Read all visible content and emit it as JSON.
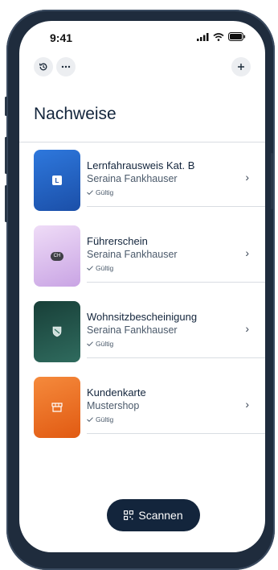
{
  "status_bar": {
    "time": "9:41"
  },
  "header": {
    "history_icon": "history-icon",
    "more_icon": "more-icon",
    "add_icon": "plus-icon"
  },
  "page": {
    "title": "Nachweise"
  },
  "cards": [
    {
      "title": "Lernfahrausweis Kat. B",
      "subtitle": "Seraina Fankhauser",
      "status": "Gültig",
      "badge": "L",
      "color": "#2563c9"
    },
    {
      "title": "Führerschein",
      "subtitle": "Seraina Fankhauser",
      "status": "Gültig",
      "badge": "CH",
      "color": "#d9b6ea"
    },
    {
      "title": "Wohnsitzbescheinigung",
      "subtitle": "Seraina Fankhauser",
      "status": "Gültig",
      "badge": "",
      "color": "#1f5248"
    },
    {
      "title": "Kundenkarte",
      "subtitle": "Mustershop",
      "status": "Gültig",
      "badge": "",
      "color": "#ea6a1c"
    }
  ],
  "scan_button": {
    "label": "Scannen"
  }
}
